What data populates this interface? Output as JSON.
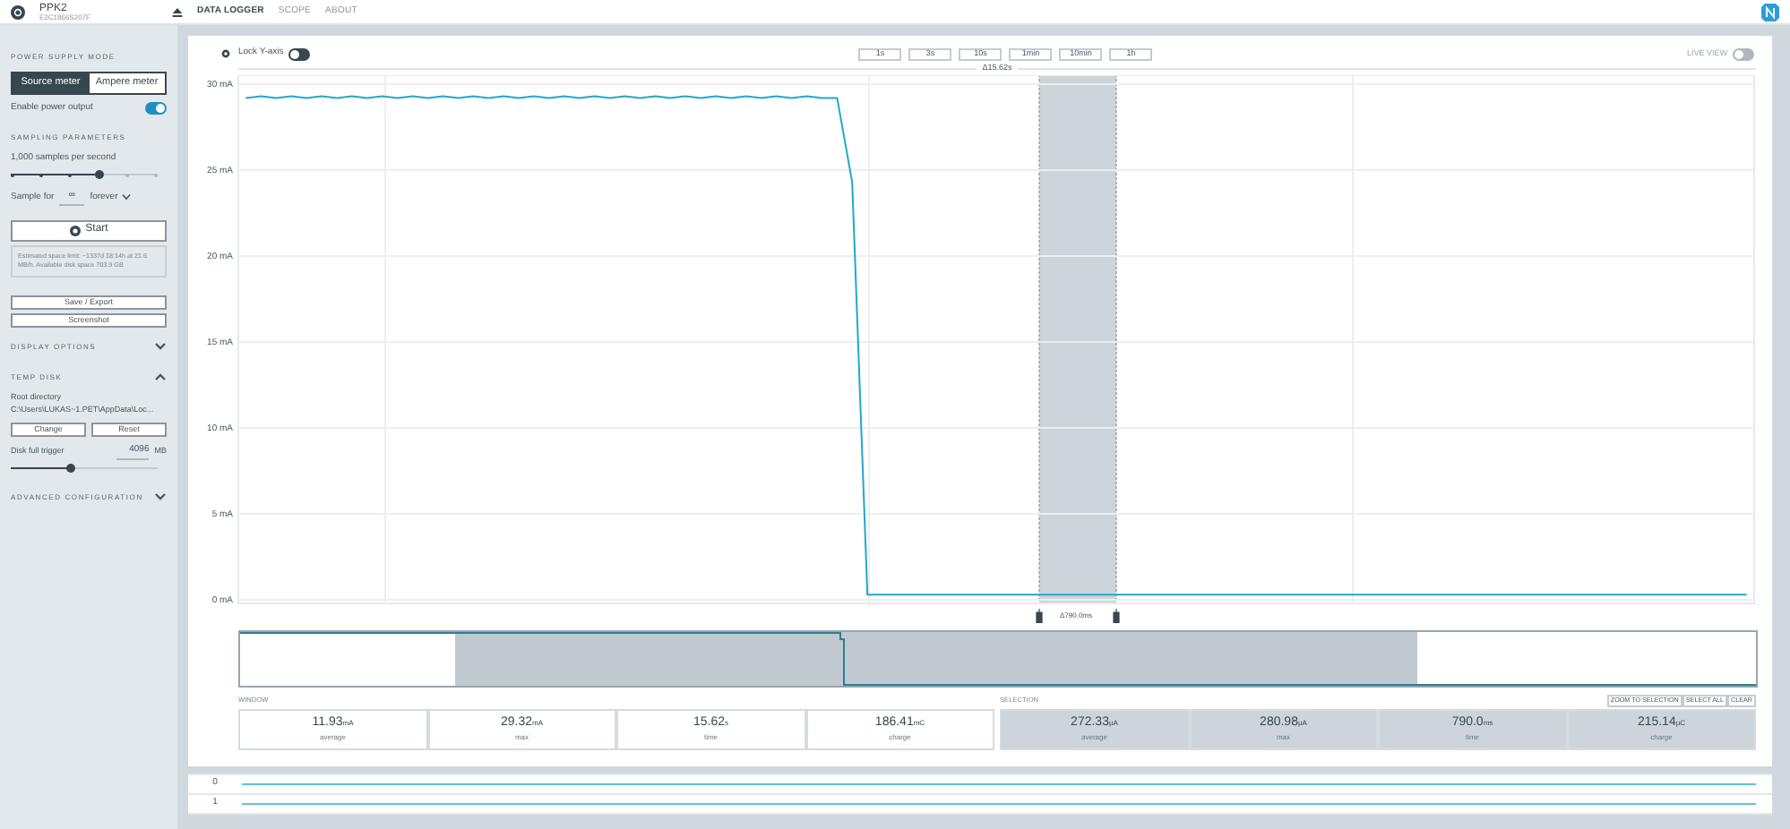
{
  "header": {
    "device": "PPK2",
    "serial": "E2C1866S207F",
    "tabs": [
      {
        "label": "DATA LOGGER",
        "selected": true
      },
      {
        "label": "SCOPE",
        "selected": false
      },
      {
        "label": "ABOUT",
        "selected": false
      }
    ]
  },
  "sidebar": {
    "power_supply": {
      "heading": "POWER SUPPLY MODE",
      "modes": [
        {
          "label": "Source meter",
          "selected": true
        },
        {
          "label": "Ampere meter",
          "selected": false
        }
      ],
      "enable_output": {
        "label": "Enable power output",
        "on": true
      }
    },
    "sampling": {
      "heading": "SAMPLING PARAMETERS",
      "rate_label": "1,000 samples per second",
      "rate_slider": {
        "level": 0.6
      },
      "sample_for_label": "Sample for",
      "duration": "∞",
      "duration_unit": "forever"
    },
    "start_button": "Start",
    "estimate": "Estimated space limit: ~1337d 18:14h at 21.6 MB/h. Available disk space 703.9 GB",
    "save_button": "Save / Export",
    "screenshot_button": "Screenshot",
    "display_options": {
      "label": "DISPLAY OPTIONS",
      "expanded": false
    },
    "temp_disk": {
      "label": "TEMP DISK",
      "expanded": true,
      "root_label": "Root directory",
      "root_path": "C:\\Users\\LUKAS~1.PET\\AppData\\Loc...",
      "change_button": "Change",
      "reset_button": "Reset",
      "trigger_label": "Disk full trigger",
      "trigger_value": "4096",
      "trigger_unit": "MB",
      "trigger_slider": {
        "level": 0.4
      }
    },
    "advanced": {
      "label": "ADVANCED CONFIGURATION",
      "expanded": false
    }
  },
  "chart": {
    "lock_y": {
      "label": "Lock Y-axis",
      "on": false
    },
    "zoom_buttons": [
      "1s",
      "3s",
      "10s",
      "1min",
      "10min",
      "1h"
    ],
    "live_view": {
      "label": "LIVE VIEW",
      "on": false
    },
    "span_label": "Δ15.62s",
    "chart_data": {
      "type": "line",
      "grid": true,
      "ylim": [
        0,
        30
      ],
      "yticks": [
        {
          "value": 0,
          "label": "0 mA"
        },
        {
          "value": 5,
          "label": "5 mA"
        },
        {
          "value": 10,
          "label": "10 mA"
        },
        {
          "value": 15,
          "label": "15 mA"
        },
        {
          "value": 20,
          "label": "20 mA"
        },
        {
          "value": 25,
          "label": "25 mA"
        },
        {
          "value": 30,
          "label": "30 mA"
        }
      ],
      "categories": [
        null,
        null,
        null,
        null,
        null,
        null,
        null,
        null,
        null,
        null,
        null,
        null,
        null,
        null,
        null,
        null,
        null,
        null,
        null,
        null,
        null,
        null,
        null,
        null,
        null,
        null,
        null,
        null,
        null,
        null,
        null,
        null,
        null,
        null,
        null,
        null,
        null,
        null,
        null,
        null,
        null,
        null,
        null,
        null,
        null,
        null,
        null,
        null,
        null,
        null,
        null,
        null,
        null,
        null,
        null,
        null,
        null,
        null,
        null,
        null,
        null,
        null,
        null,
        null,
        null,
        null,
        null,
        null,
        null,
        null,
        null,
        null,
        null,
        null,
        null,
        null,
        null,
        null,
        null,
        null,
        null,
        null,
        null,
        null,
        null,
        null,
        null,
        null,
        null,
        null,
        null,
        null,
        null,
        null,
        null,
        null,
        null,
        null,
        null,
        null
      ],
      "values": [
        29.2,
        29.3,
        29.2,
        29.3,
        29.2,
        29.3,
        29.2,
        29.3,
        29.2,
        29.3,
        29.2,
        29.3,
        29.2,
        29.3,
        29.2,
        29.3,
        29.2,
        29.3,
        29.2,
        29.3,
        29.2,
        29.3,
        29.2,
        29.3,
        29.2,
        29.3,
        29.2,
        29.3,
        29.2,
        29.3,
        29.2,
        29.3,
        29.2,
        29.3,
        29.2,
        29.3,
        29.2,
        29.3,
        29.2,
        29.2,
        24.3,
        0.3,
        0.3,
        0.3,
        0.3,
        0.3,
        0.3,
        0.3,
        0.3,
        0.3,
        0.3,
        0.3,
        0.3,
        0.3,
        0.3,
        0.3,
        0.3,
        0.3,
        0.3,
        0.3,
        0.3,
        0.3,
        0.3,
        0.3,
        0.3,
        0.3,
        0.3,
        0.3,
        0.3,
        0.3,
        0.3,
        0.3,
        0.3,
        0.3,
        0.3,
        0.3,
        0.3,
        0.3,
        0.3,
        0.3,
        0.3,
        0.3,
        0.3,
        0.3,
        0.3,
        0.3,
        0.3,
        0.3,
        0.3,
        0.3,
        0.3,
        0.3,
        0.3,
        0.3,
        0.3,
        0.3,
        0.3,
        0.3,
        0.3,
        0.3
      ]
    },
    "selection_label": "Δ790.0ms"
  },
  "window_stats": {
    "heading": "WINDOW",
    "stats": [
      {
        "value": "11.93",
        "unit": "mA",
        "label": "average"
      },
      {
        "value": "29.32",
        "unit": "mA",
        "label": "max"
      },
      {
        "value": "15.62",
        "unit": "s",
        "label": "time"
      },
      {
        "value": "186.41",
        "unit": "mC",
        "label": "charge"
      }
    ]
  },
  "selection_stats": {
    "heading": "SELECTION",
    "buttons": [
      "ZOOM TO SELECTION",
      "SELECT ALL",
      "CLEAR"
    ],
    "stats": [
      {
        "value": "272.33",
        "unit": "µA",
        "label": "average"
      },
      {
        "value": "280.98",
        "unit": "µA",
        "label": "max"
      },
      {
        "value": "790.0",
        "unit": "ms",
        "label": "time"
      },
      {
        "value": "215.14",
        "unit": "µC",
        "label": "charge"
      }
    ]
  },
  "digital_channels": [
    "0",
    "1"
  ]
}
